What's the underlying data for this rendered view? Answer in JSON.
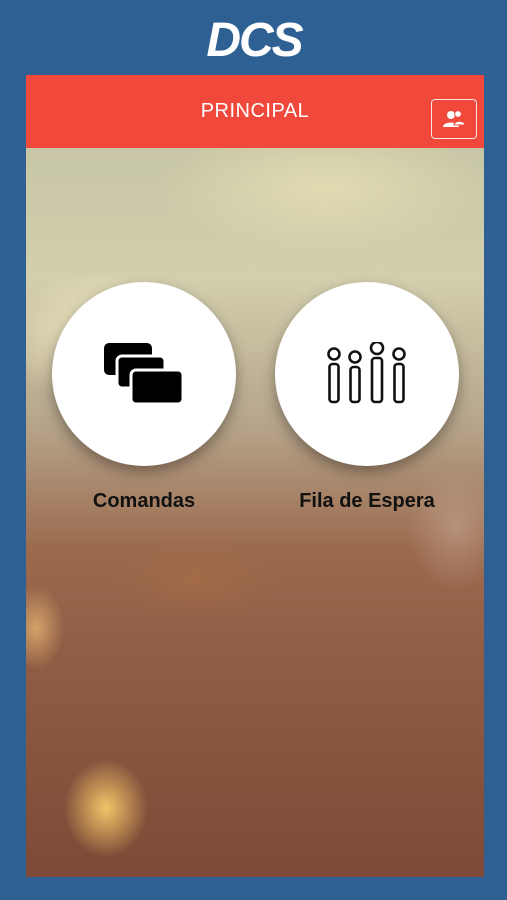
{
  "brand": {
    "logo_text": "DCS"
  },
  "header": {
    "title": "PRINCIPAL",
    "user_icon": "users-icon"
  },
  "menu": [
    {
      "label": "Comandas",
      "icon": "cards-icon"
    },
    {
      "label": "Fila de Espera",
      "icon": "queue-people-icon"
    }
  ],
  "colors": {
    "background": "#2f6094",
    "header": "#f1483c",
    "circle": "#ffffff"
  }
}
